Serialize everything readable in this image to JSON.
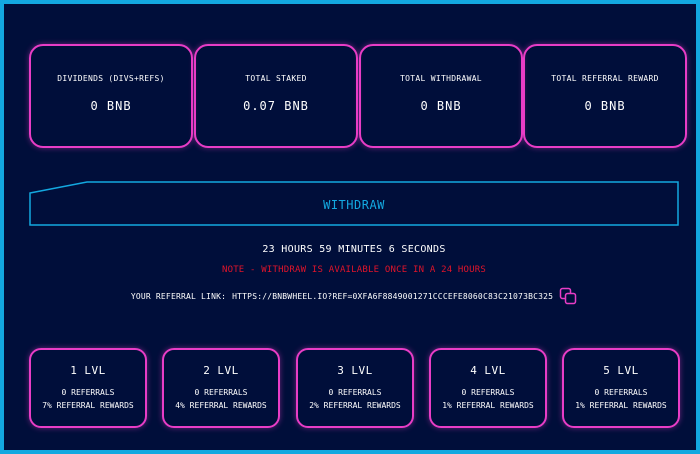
{
  "stats": [
    {
      "label": "Dividends (divs+refs)",
      "value": "0 BNB"
    },
    {
      "label": "Total Staked",
      "value": "0.07 BNB"
    },
    {
      "label": "Total Withdrawal",
      "value": "0 BNB"
    },
    {
      "label": "Total Referral Reward",
      "value": "0 BNB"
    }
  ],
  "withdraw": {
    "label": "WITHDRAW"
  },
  "timer": "23 hours 59 minutes 6 seconds",
  "note": "Note - Withdraw is available once in a 24 hours",
  "referral": {
    "label": "Your referral link:",
    "link": "https://bnbwheel.io?ref=0xfa6f8849001271cccefe8060c83c21073bc325"
  },
  "levels": [
    {
      "title": "1 LVL",
      "referrals": "0 Referrals",
      "reward": "7% Referral Rewards"
    },
    {
      "title": "2 LVL",
      "referrals": "0 Referrals",
      "reward": "4% Referral Rewards"
    },
    {
      "title": "3 LVL",
      "referrals": "0 Referrals",
      "reward": "2% Referral Rewards"
    },
    {
      "title": "4 LVL",
      "referrals": "0 Referrals",
      "reward": "1% Referral Rewards"
    },
    {
      "title": "5 LVL",
      "referrals": "0 Referrals",
      "reward": "1% Referral Rewards"
    }
  ],
  "colors": {
    "background": "#000e3a",
    "frame": "#13a8e0",
    "card_border": "#e83dc6",
    "note": "#e0142a",
    "withdraw": "#13a8e0"
  },
  "icons": {
    "copy": "copy-icon"
  }
}
